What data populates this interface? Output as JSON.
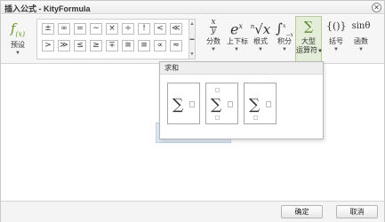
{
  "window": {
    "title": "插入公式 - KityFormula",
    "close_glyph": "✕"
  },
  "toolbar": {
    "preset": {
      "glyph": "f",
      "sub": "(x)",
      "label": "预设"
    },
    "symbols": [
      "±",
      "∞",
      "=",
      "∼",
      "×",
      "÷",
      "!",
      "<",
      "≪",
      ">",
      "≫",
      "≤",
      "≥",
      "∓",
      "≅",
      "≡",
      "∝",
      "≈"
    ],
    "groups": [
      {
        "key": "fraction",
        "label": "分数"
      },
      {
        "key": "script",
        "label": "上下标",
        "glyph": "e",
        "sup": "x"
      },
      {
        "key": "radical",
        "label": "根式",
        "glyph": "√x",
        "sup": "n"
      },
      {
        "key": "integral",
        "label": "积分",
        "glyph": "∫",
        "sup": "x",
        "sub": "−x"
      },
      {
        "key": "largeop",
        "label": "大型运算符",
        "label_line1": "大型",
        "label_line2": "运算符",
        "glyph": "∑"
      },
      {
        "key": "bracket",
        "label": "括号",
        "glyph": "{()}"
      },
      {
        "key": "function",
        "label": "函数",
        "glyph": "sinθ"
      }
    ],
    "fraction_glyph": {
      "num": "x",
      "den": "y"
    }
  },
  "dropdown": {
    "header": "求和",
    "items": [
      {
        "glyph": "∑"
      },
      {
        "glyph": "∑"
      },
      {
        "glyph": "∑"
      }
    ]
  },
  "footer": {
    "ok_label": "确定",
    "cancel_label": "取消"
  }
}
